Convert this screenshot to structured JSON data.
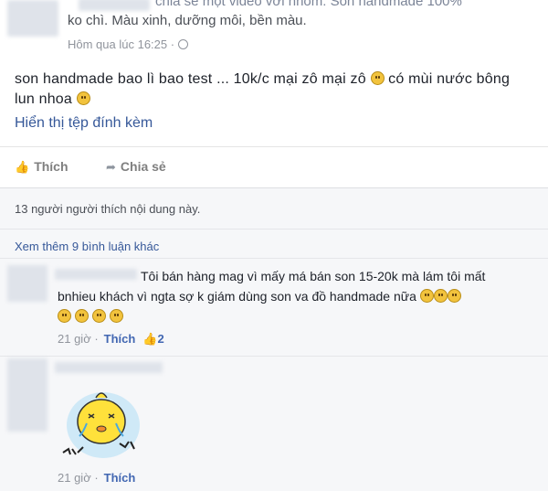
{
  "post": {
    "header_line1": "chia sẻ một video với nhóm: Son handmade 100%",
    "header_line2": "ko chì. Màu xinh, dưỡng môi, bền màu.",
    "timestamp": "Hôm qua lúc 16:25 ·",
    "body_text": "son handmade bao lì bao test ... 10k/c mại zô mại zô",
    "body_text_2": "có mùi nước bông",
    "body_text_3": "lun nhoa",
    "attachment_link": "Hiển thị tệp đính kèm"
  },
  "actions": {
    "like_label": "Thích",
    "share_label": "Chia sẻ"
  },
  "feedback": {
    "likes_summary": "13 người người thích nội dung này.",
    "view_more": "Xem thêm 9 bình luận khác"
  },
  "comments": [
    {
      "line1": "Tôi bán hàng mag vì mấy má bán son 15-20k mà lám tôi mất",
      "line2": "bnhieu khách vì ngta sợ k giám dùng son va đồ handmade nữa",
      "time": "21 giờ ·",
      "like_label": "Thích",
      "like_count": "2"
    },
    {
      "time": "21 giờ ·",
      "like_label": "Thích"
    }
  ],
  "icons": {
    "like": "thumbs-up-icon",
    "share": "share-arrow-icon",
    "globe": "globe-icon",
    "emoji": "smiley-emoji-icon"
  },
  "colors": {
    "link": "#365899",
    "muted": "#90949c",
    "feedback_bg": "#f6f7f9"
  }
}
